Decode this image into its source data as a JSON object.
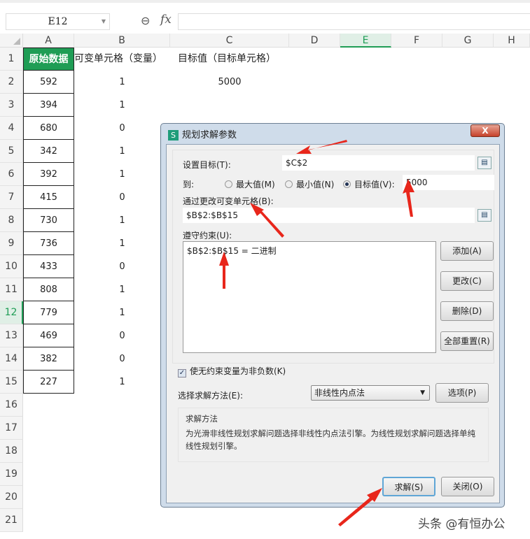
{
  "formula_bar": {
    "name_box": "E12",
    "zoom_icon": "magnify-icon",
    "fx_label": "fx",
    "formula": ""
  },
  "columns": [
    "A",
    "B",
    "C",
    "D",
    "E",
    "F",
    "G",
    "H"
  ],
  "selected_column": "E",
  "selected_row": 12,
  "rows": [
    {
      "n": "1",
      "a": "原始数据",
      "b": "可变单元格（变量）",
      "c": "目标值（目标单元格）"
    },
    {
      "n": "2",
      "a": "592",
      "b": "1",
      "c": "5000"
    },
    {
      "n": "3",
      "a": "394",
      "b": "1",
      "c": ""
    },
    {
      "n": "4",
      "a": "680",
      "b": "0",
      "c": ""
    },
    {
      "n": "5",
      "a": "342",
      "b": "1",
      "c": ""
    },
    {
      "n": "6",
      "a": "392",
      "b": "1",
      "c": ""
    },
    {
      "n": "7",
      "a": "415",
      "b": "0",
      "c": ""
    },
    {
      "n": "8",
      "a": "730",
      "b": "1",
      "c": ""
    },
    {
      "n": "9",
      "a": "736",
      "b": "1",
      "c": ""
    },
    {
      "n": "10",
      "a": "433",
      "b": "0",
      "c": ""
    },
    {
      "n": "11",
      "a": "808",
      "b": "1",
      "c": ""
    },
    {
      "n": "12",
      "a": "779",
      "b": "1",
      "c": ""
    },
    {
      "n": "13",
      "a": "469",
      "b": "0",
      "c": ""
    },
    {
      "n": "14",
      "a": "382",
      "b": "0",
      "c": ""
    },
    {
      "n": "15",
      "a": "227",
      "b": "1",
      "c": ""
    },
    {
      "n": "16"
    },
    {
      "n": "17"
    },
    {
      "n": "18"
    },
    {
      "n": "19"
    },
    {
      "n": "20"
    },
    {
      "n": "21"
    }
  ],
  "dialog": {
    "icon": "S",
    "title": "规划求解参数",
    "close": "X",
    "set_objective_label": "设置目标(T):",
    "set_objective": "$C$2",
    "to_label": "到:",
    "opt_max": "最大值(M)",
    "opt_min": "最小值(N)",
    "opt_value": "目标值(V):",
    "target_value": "5000",
    "selected_option": "value",
    "changing_label": "通过更改可变单元格(B):",
    "changing_cells": "$B$2:$B$15",
    "constraints_label": "遵守约束(U):",
    "constraints": [
      "$B$2:$B$15 = 二进制"
    ],
    "add": "添加(A)",
    "change": "更改(C)",
    "delete": "删除(D)",
    "reset_all": "全部重置(R)",
    "nonneg_label": "使无约束变量为非负数(K)",
    "nonneg_checked": true,
    "method_label": "选择求解方法(E):",
    "method": "非线性内点法",
    "options": "选项(P)",
    "desc_title": "求解方法",
    "desc_text": "为光滑非线性规划求解问题选择非线性内点法引擎。为线性规划求解问题选择单纯线性规划引擎。",
    "solve": "求解(S)",
    "close_btn": "关闭(O)"
  },
  "watermark": "头条 @有恒办公",
  "colors": {
    "accent": "#1f9d55",
    "arrow": "#e8261b"
  }
}
